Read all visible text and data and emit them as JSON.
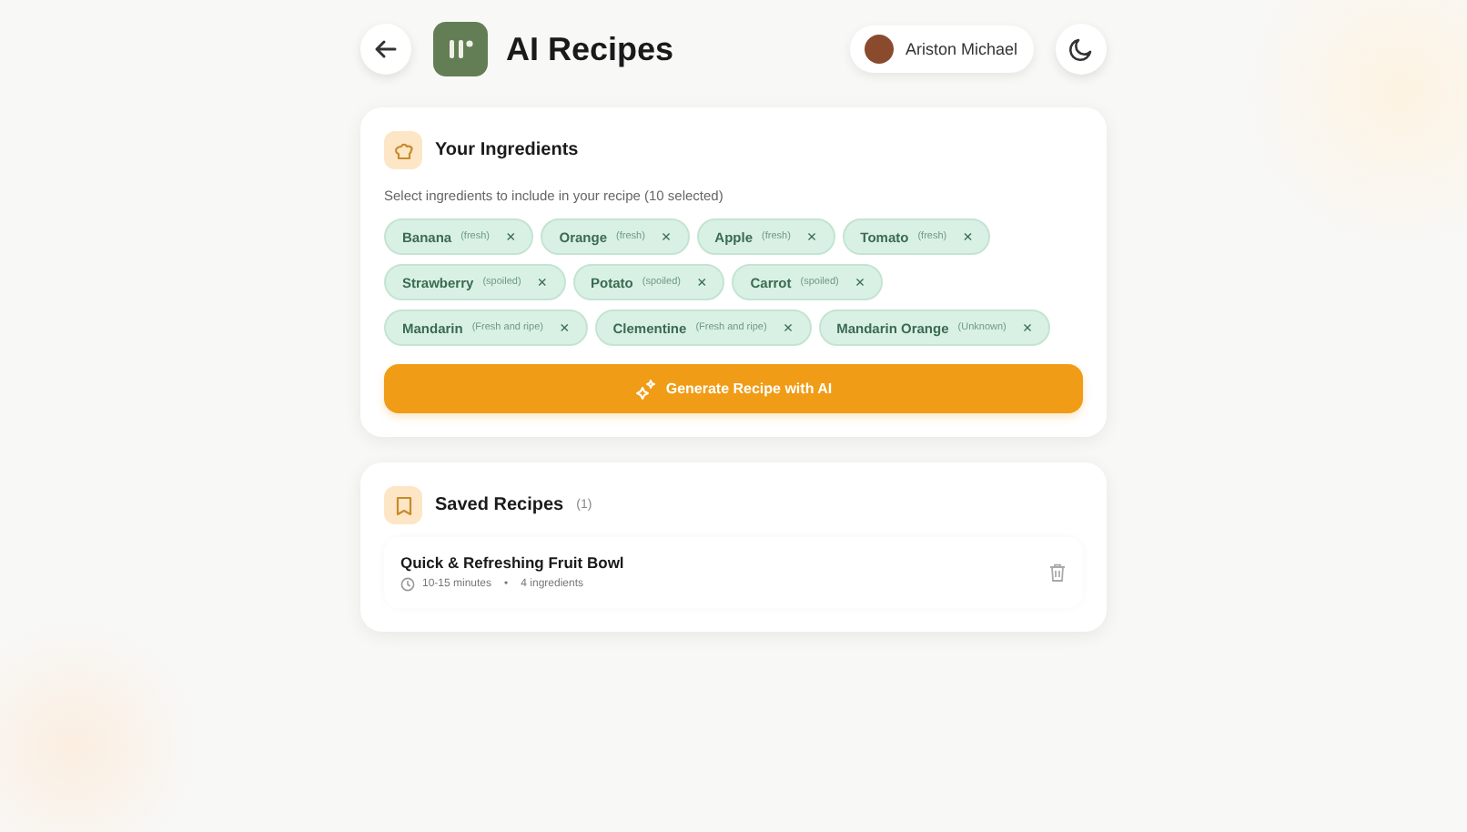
{
  "header": {
    "title": "AI Recipes",
    "user": "Ariston Michael"
  },
  "ingredients": {
    "title": "Your Ingredients",
    "subtitle": "Select ingredients to include in your recipe (10 selected)",
    "remove_glyph": "×",
    "items": [
      {
        "name": "Banana",
        "note": "(fresh)"
      },
      {
        "name": "Orange",
        "note": "(fresh)"
      },
      {
        "name": "Apple",
        "note": "(fresh)"
      },
      {
        "name": "Tomato",
        "note": "(fresh)"
      },
      {
        "name": "Strawberry",
        "note": "(spoiled)"
      },
      {
        "name": "Potato",
        "note": "(spoiled)"
      },
      {
        "name": "Carrot",
        "note": "(spoiled)"
      },
      {
        "name": "Mandarin",
        "note": "(Fresh and ripe)"
      },
      {
        "name": "Clementine",
        "note": "(Fresh and ripe)"
      },
      {
        "name": "Mandarin Orange",
        "note": "(Unknown)"
      }
    ],
    "button": "Generate Recipe with AI"
  },
  "saved": {
    "title": "Saved Recipes",
    "count": "(1)",
    "recipes": [
      {
        "name": "Quick & Refreshing Fruit Bowl",
        "time": "10-15 minutes",
        "separator": "•",
        "ingredients": "4 ingredients"
      }
    ]
  }
}
